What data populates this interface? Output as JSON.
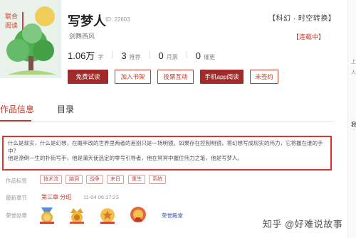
{
  "book": {
    "cover_text": "联合阅读",
    "title": "写梦人",
    "id_label": "ID: 22603",
    "author": "剑舞西风",
    "genre": "【科幻 · 时空转换】",
    "status": "【连载中】"
  },
  "stats": [
    {
      "num": "1.06万",
      "unit": "字"
    },
    {
      "num": "3",
      "unit": "推荐"
    },
    {
      "num": "0",
      "unit": "月票"
    },
    {
      "num": "0",
      "unit": "催更"
    }
  ],
  "actions": {
    "free_read": "免费试读",
    "add_shelf": "加入书架",
    "vote": "投票互动",
    "app_read": "手机app阅读",
    "unsigned": "未签约"
  },
  "tabs": {
    "info": "作品信息",
    "catalog": "目录"
  },
  "synopsis": {
    "line1": "什么是现实，什么是幻想，在概率改的世界里两者的差别只是一场明镜。如果存在控制明镜，将幻想写成现实的伟力，它将握在谁的手中？",
    "line2": "他是潦倒一生的扑街写手，他是蒲天使选定的零号引导者，他在冥冥中握住伟力之笔，他是写梦人。"
  },
  "labels": {
    "tags": "作品标签",
    "latest": "最新章节",
    "honors": "荣誉勋章"
  },
  "tags": [
    "技术流",
    "脑洞",
    "战争",
    "末日",
    "重生",
    "系统"
  ],
  "latest": {
    "title": "第三章 分班",
    "time": "11-04 06:17:23"
  },
  "honor_name": "荣誉殿堂",
  "watermark": "知乎 @好难说故事",
  "colors": {
    "accent": "#c0392b",
    "button_red": "#a12b2b",
    "highlight_border": "#d9362b"
  }
}
